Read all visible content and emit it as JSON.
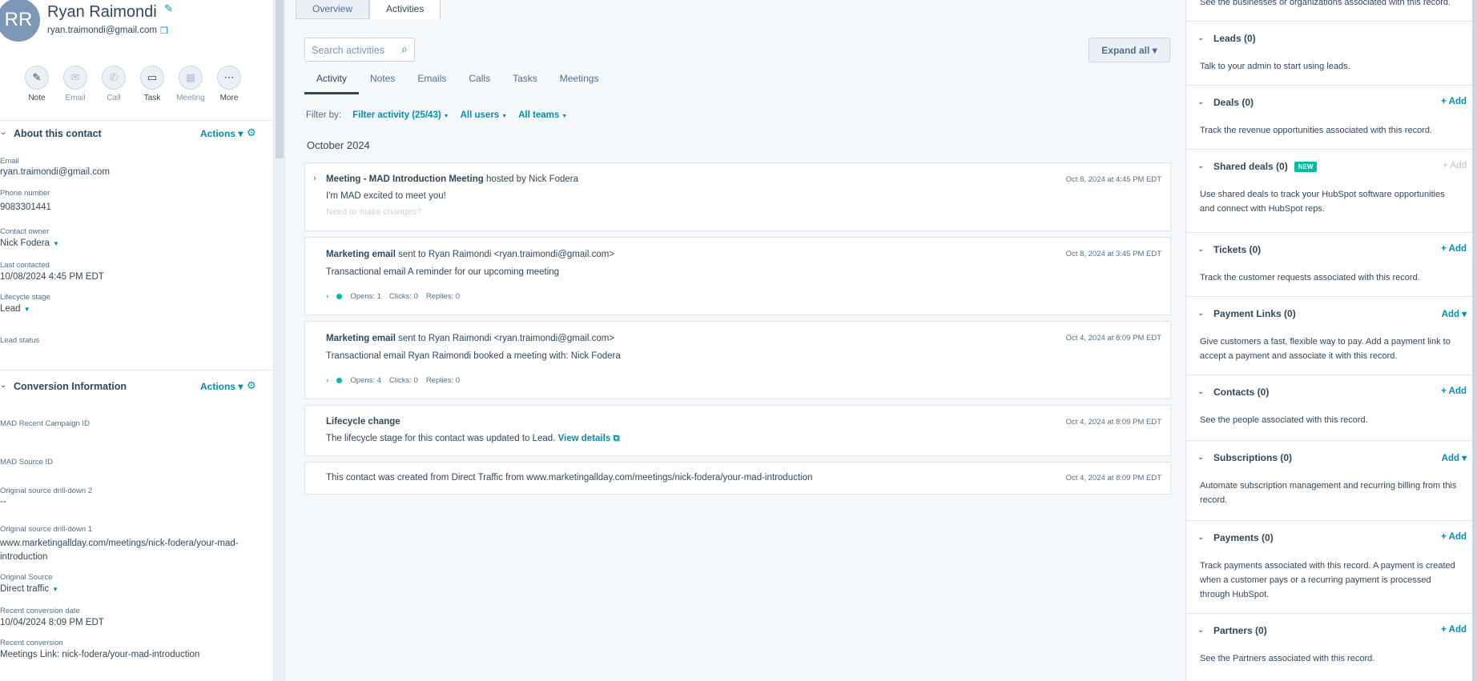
{
  "contact": {
    "initials": "RR",
    "name": "Ryan Raimondi",
    "email": "ryan.traimondi@gmail.com"
  },
  "quick_actions": [
    {
      "label": "Note",
      "icon": "✎"
    },
    {
      "label": "Email",
      "icon": "✉"
    },
    {
      "label": "Call",
      "icon": "✆"
    },
    {
      "label": "Task",
      "icon": "▭"
    },
    {
      "label": "Meeting",
      "icon": "▦"
    },
    {
      "label": "More",
      "icon": "⋯"
    }
  ],
  "about": {
    "title": "About this contact",
    "actions_label": "Actions",
    "props": [
      {
        "label": "Email",
        "value": "ryan.traimondi@gmail.com"
      },
      {
        "label": "Phone number",
        "value": "9083301441"
      },
      {
        "label": "Contact owner",
        "value": "Nick Fodera"
      },
      {
        "label": "Last contacted",
        "value": "10/08/2024 4:45 PM EDT"
      },
      {
        "label": "Lifecycle stage",
        "value": "Lead"
      },
      {
        "label": "Lead status",
        "value": ""
      }
    ]
  },
  "conversion": {
    "title": "Conversion Information",
    "actions_label": "Actions",
    "props": [
      {
        "label": "MAD Recent Campaign ID",
        "value": ""
      },
      {
        "label": "MAD Source ID",
        "value": ""
      },
      {
        "label": "Original source drill-down 2",
        "value": "--"
      },
      {
        "label": "Original source drill-down 1",
        "value": "www.marketingallday.com/meetings/nick-fodera/your-mad-introduction"
      },
      {
        "label": "Original Source",
        "value": "Direct traffic"
      },
      {
        "label": "Recent conversion date",
        "value": "10/04/2024 8:09 PM EDT"
      },
      {
        "label": "Recent conversion",
        "value": "Meetings Link: nick-fodera/your-mad-introduction"
      }
    ]
  },
  "tabs": {
    "overview": "Overview",
    "activities": "Activities"
  },
  "search": {
    "placeholder": "Search activities"
  },
  "expand_all": "Expand all",
  "sub_tabs": [
    "Activity",
    "Notes",
    "Emails",
    "Calls",
    "Tasks",
    "Meetings"
  ],
  "filter": {
    "label": "Filter by:",
    "activity": "Filter activity (25/43)",
    "users": "All users",
    "teams": "All teams"
  },
  "month": "October 2024",
  "activities": [
    {
      "title_bold": "Meeting - MAD Introduction Meeting",
      "title_rest": " hosted by Nick Fodera",
      "date": "Oct 8, 2024 at 4:45 PM EDT",
      "body": "I'm MAD excited to meet you!",
      "fade": "Need to make changes?"
    },
    {
      "title_bold": "Marketing email",
      "title_rest": " sent to Ryan Raimondi <ryan.traimondi@gmail.com>",
      "date": "Oct 8, 2024 at 3:45 PM EDT",
      "body": "Transactional email A reminder for our upcoming meeting",
      "opens": "Opens: 1",
      "clicks": "Clicks: 0",
      "replies": "Replies: 0"
    },
    {
      "title_bold": "Marketing email",
      "title_rest": " sent to Ryan Raimondi <ryan.traimondi@gmail.com>",
      "date": "Oct 4, 2024 at 8:09 PM EDT",
      "body": "Transactional email Ryan Raimondi booked a meeting with: Nick Fodera",
      "opens": "Opens: 4",
      "clicks": "Clicks: 0",
      "replies": "Replies: 0"
    },
    {
      "title_bold": "Lifecycle change",
      "title_rest": "",
      "date": "Oct 4, 2024 at 8:09 PM EDT",
      "body": "The lifecycle stage for this contact was updated to Lead.",
      "link": "View details"
    },
    {
      "title_bold": "",
      "title_rest": "This contact was created from Direct Traffic from www.marketingallday.com/meetings/nick-fodera/your-mad-introduction",
      "date": "Oct 4, 2024 at 8:09 PM EDT"
    }
  ],
  "right": {
    "top_text": "See the businesses or organizations associated with this record.",
    "sections": [
      {
        "title": "Leads (0)",
        "add": "",
        "desc": "Talk to your admin to start using leads."
      },
      {
        "title": "Deals (0)",
        "add": "+ Add",
        "desc": "Track the revenue opportunities associated with this record."
      },
      {
        "title": "Shared deals (0)",
        "badge": "NEW",
        "add": "+ Add",
        "desc": "Use shared deals to track your HubSpot software opportunities and connect with HubSpot reps."
      },
      {
        "title": "Tickets (0)",
        "add": "+ Add",
        "desc": "Track the customer requests associated with this record."
      },
      {
        "title": "Payment Links (0)",
        "add": "Add ▾",
        "desc": "Give customers a fast, flexible way to pay. Add a payment link to accept a payment and associate it with this record."
      },
      {
        "title": "Contacts (0)",
        "add": "+ Add",
        "desc": "See the people associated with this record."
      },
      {
        "title": "Subscriptions (0)",
        "add": "Add ▾",
        "desc": "Automate subscription management and recurring billing from this record."
      },
      {
        "title": "Payments (0)",
        "add": "+ Add",
        "desc": "Track payments associated with this record. A payment is created when a customer pays or a recurring payment is processed through HubSpot."
      },
      {
        "title": "Partners (0)",
        "add": "+ Add",
        "desc": "See the Partners associated with this record."
      }
    ]
  },
  "colors": {
    "accent": "#0091ae",
    "text": "#33475b",
    "badge": "#00bda5",
    "avatar": "#7c98b6"
  }
}
